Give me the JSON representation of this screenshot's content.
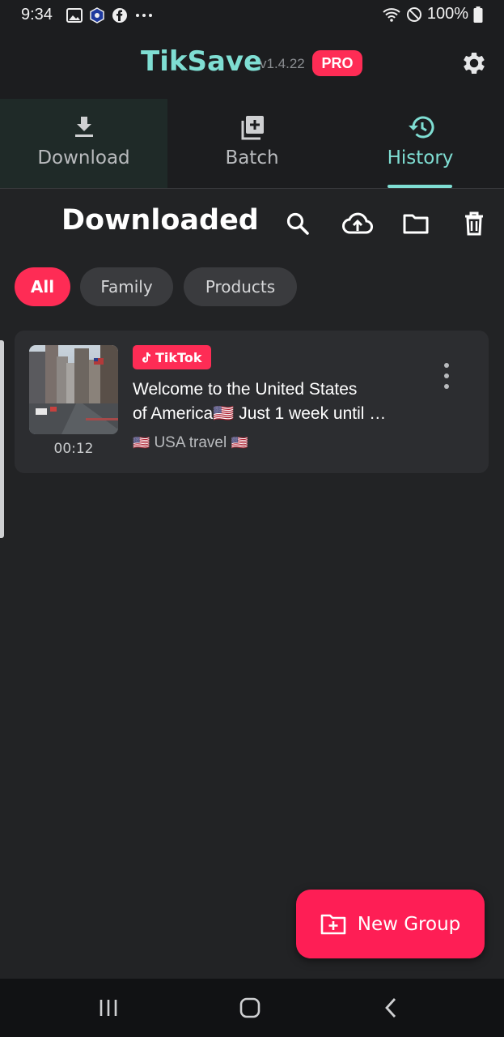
{
  "status_bar": {
    "time": "9:34",
    "battery": "100%",
    "left_icons": [
      "gallery-icon",
      "crypto-app-icon",
      "facebook-icon",
      "more-dots-icon"
    ],
    "right_icons": [
      "wifi-icon",
      "do-not-disturb-icon",
      "battery-icon"
    ]
  },
  "header": {
    "title": "TikSave",
    "version": "v1.4.22",
    "pro_badge": "PRO",
    "settings_icon": "gear-icon"
  },
  "tabs": [
    {
      "label": "Download",
      "icon": "download-icon",
      "active": false
    },
    {
      "label": "Batch",
      "icon": "add-box-icon",
      "active": false
    },
    {
      "label": "History",
      "icon": "history-icon",
      "active": true
    }
  ],
  "section": {
    "title": "Downloaded",
    "tools": [
      "search-icon",
      "cloud-upload-icon",
      "folder-icon",
      "trash-icon"
    ]
  },
  "filters": [
    {
      "label": "All",
      "active": true
    },
    {
      "label": "Family",
      "active": false
    },
    {
      "label": "Products",
      "active": false
    }
  ],
  "items": [
    {
      "duration": "00:12",
      "platform": "TikTok",
      "title_line1": "Welcome to the United States",
      "title_line2": "of America🇺🇸 Just 1 week until …",
      "group": "USA travel"
    }
  ],
  "fab": {
    "label": "New Group",
    "icon": "folder-add-icon"
  },
  "colors": {
    "accent": "#7fded3",
    "brand": "#fe2c55",
    "background": "#222325",
    "card": "#2c2d30"
  }
}
